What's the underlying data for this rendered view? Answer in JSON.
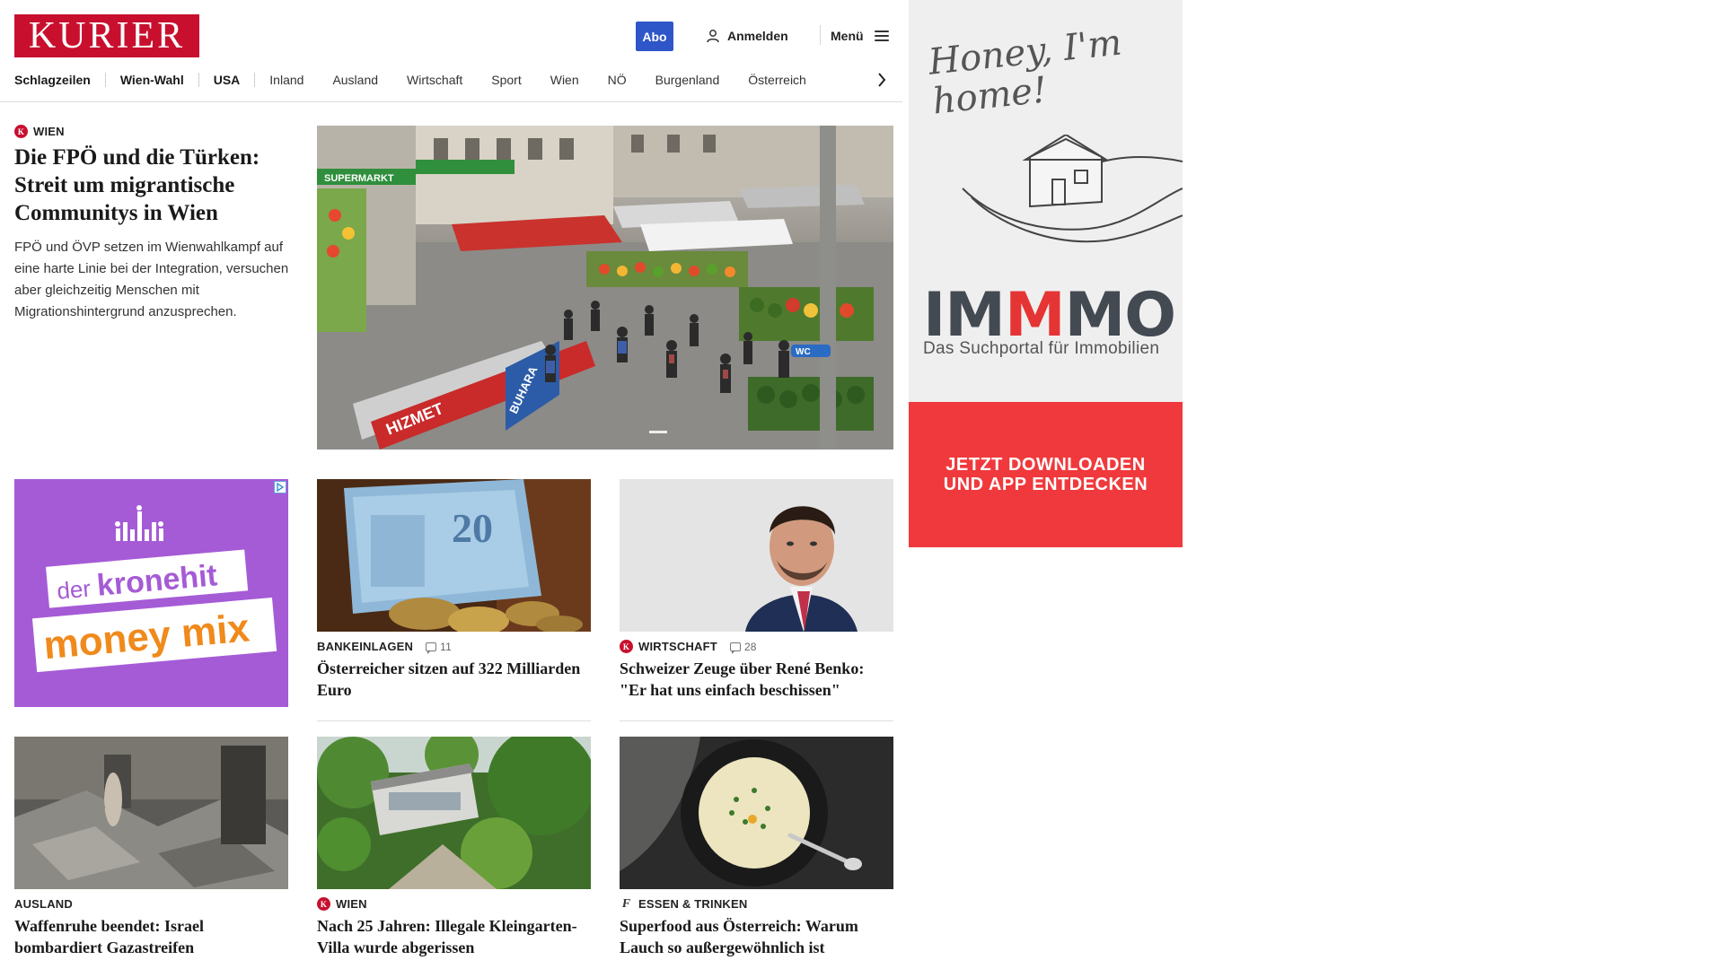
{
  "header": {
    "logo": "KURIER",
    "abo": "Abo",
    "login": "Anmelden",
    "menu": "Menü"
  },
  "nav": {
    "items": [
      "Schlagzeilen",
      "Wien-Wahl",
      "USA",
      "Inland",
      "Ausland",
      "Wirtschaft",
      "Sport",
      "Wien",
      "NÖ",
      "Burgenland",
      "Österreich"
    ]
  },
  "lead": {
    "kicker": "WIEN",
    "title": "Die FPÖ und die Türken: Streit um migrantische Communitys in Wien",
    "teaser": "FPÖ und ÖVP setzen im Wienwahlkampf auf eine harte Linie bei der Integration, versuchen aber gleichzeitig Menschen mit Migrationshintergrund anzusprechen.",
    "image_text": {
      "supermarkt": "SUPERMARKT",
      "hizmet": "HIZMET",
      "buhara": "BUHARA",
      "wc": "WC"
    }
  },
  "ad_kronehit": {
    "line1": "der",
    "line2": "kronehit",
    "line3": "money mix"
  },
  "cards": [
    {
      "kicker": "BANKEINLAGEN",
      "comments": "11",
      "title": "Österreicher sitzen auf 322 Milliarden Euro",
      "badge": ""
    },
    {
      "kicker": "WIRTSCHAFT",
      "comments": "28",
      "title": "Schweizer Zeuge über René Benko: \"Er hat uns einfach beschissen\"",
      "badge": "K"
    },
    {
      "kicker": "AUSLAND",
      "comments": "",
      "title": "Waffenruhe beendet: Israel bombardiert Gazastreifen",
      "badge": ""
    },
    {
      "kicker": "WIEN",
      "comments": "",
      "title": "Nach 25 Jahren: Illegale Kleingarten-Villa wurde abgerissen",
      "badge": "K"
    },
    {
      "kicker": "ESSEN & TRINKEN",
      "comments": "",
      "title": "Superfood aus Österreich: Warum Lauch so außergewöhnlich ist",
      "badge": "f"
    }
  ],
  "banknote_value": "20",
  "ad_immmo": {
    "honey": "Honey, I'm home!",
    "logo_a": "IM",
    "logo_m": "M",
    "logo_b": "MO",
    "sub": "Das Suchportal für Immobilien",
    "cta_1": "JETZT DOWNLOADEN",
    "cta_2": "UND APP ENTDECKEN"
  },
  "colors": {
    "brand_red": "#c8102e",
    "abo_blue": "#2f56c8",
    "cta_red": "#f0393c",
    "ad_purple": "#a55bd6"
  }
}
